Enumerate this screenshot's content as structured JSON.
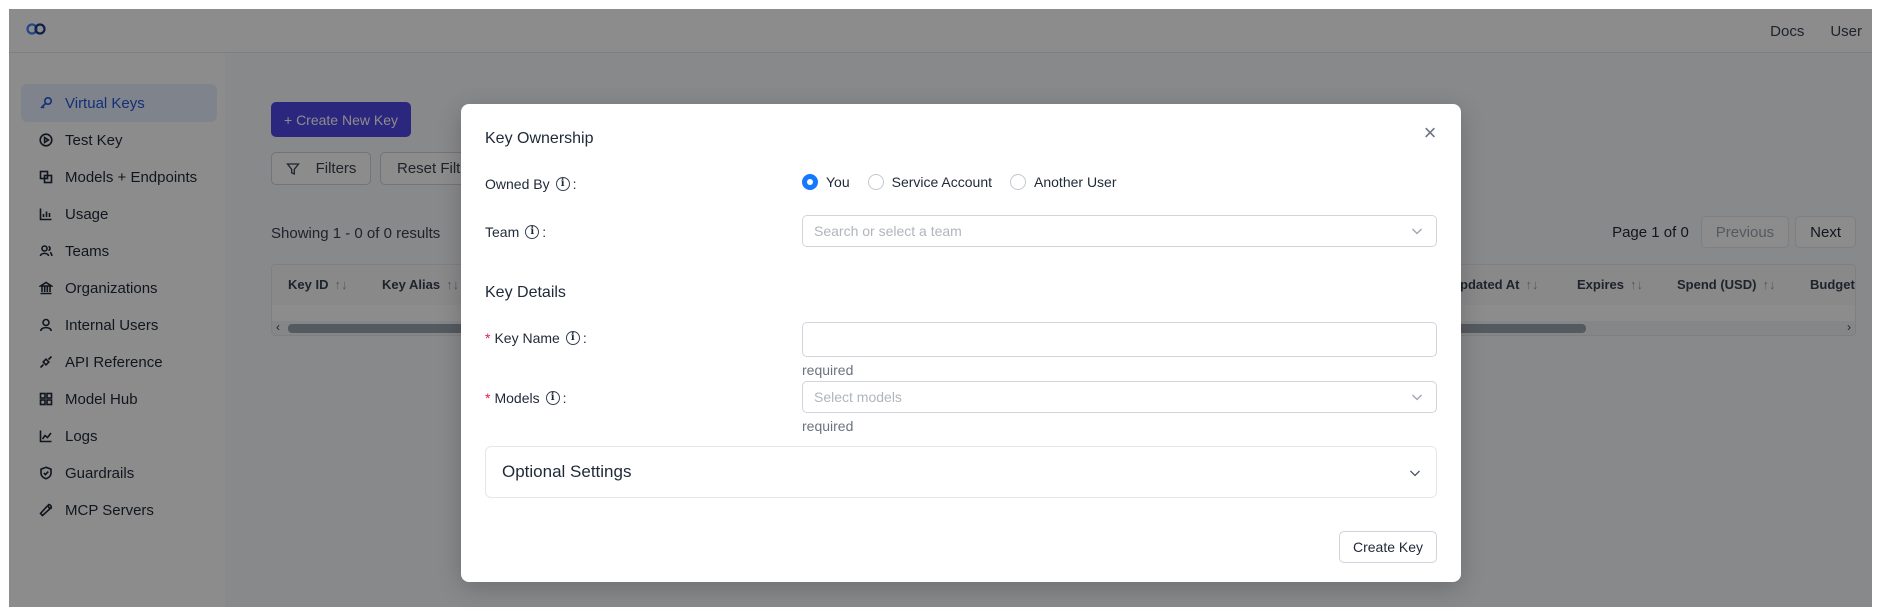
{
  "topbar": {
    "docs_label": "Docs",
    "user_label": "User"
  },
  "sidebar": {
    "items": [
      {
        "label": "Virtual Keys",
        "icon": "key-icon",
        "active": true
      },
      {
        "label": "Test Key",
        "icon": "play-circle-icon"
      },
      {
        "label": "Models + Endpoints",
        "icon": "block-icon"
      },
      {
        "label": "Usage",
        "icon": "bar-chart-icon"
      },
      {
        "label": "Teams",
        "icon": "team-icon"
      },
      {
        "label": "Organizations",
        "icon": "bank-icon"
      },
      {
        "label": "Internal Users",
        "icon": "user-icon"
      },
      {
        "label": "API Reference",
        "icon": "api-icon"
      },
      {
        "label": "Model Hub",
        "icon": "appstore-icon"
      },
      {
        "label": "Logs",
        "icon": "line-chart-icon"
      },
      {
        "label": "Guardrails",
        "icon": "safety-icon"
      },
      {
        "label": "MCP Servers",
        "icon": "tool-icon"
      }
    ]
  },
  "main": {
    "create_button": "+ Create New Key",
    "filters_button": "Filters",
    "reset_filters_button": "Reset Filter",
    "results_text": "Showing 1 - 0 of 0 results",
    "pager": {
      "page_text": "Page 1 of 0",
      "previous": "Previous",
      "next": "Next"
    },
    "table_headers_left": [
      "Key ID",
      "Key Alias"
    ],
    "table_headers_right": [
      "pdated At",
      "Expires",
      "Spend (USD)",
      "Budget ("
    ],
    "sort_glyph": "↑↓"
  },
  "modal": {
    "ownership_title": "Key Ownership",
    "owned_by_label": "Owned By",
    "owner_options": [
      "You",
      "Service Account",
      "Another User"
    ],
    "owner_selected": "You",
    "team_label": "Team",
    "team_placeholder": "Search or select a team",
    "details_title": "Key Details",
    "key_name_label": "Key Name",
    "key_name_value": "",
    "key_name_help": "required",
    "models_label": "Models",
    "models_placeholder": "Select models",
    "models_help": "required",
    "optional_settings": "Optional Settings",
    "create_button": "Create Key",
    "colon": ":",
    "required_mark": "*",
    "info_glyph": "i",
    "close_glyph": "×"
  },
  "colors": {
    "primary": "#4f46e5",
    "radio_selected": "#1677ff",
    "required": "#e11d48",
    "active_nav": "#2357d8"
  }
}
